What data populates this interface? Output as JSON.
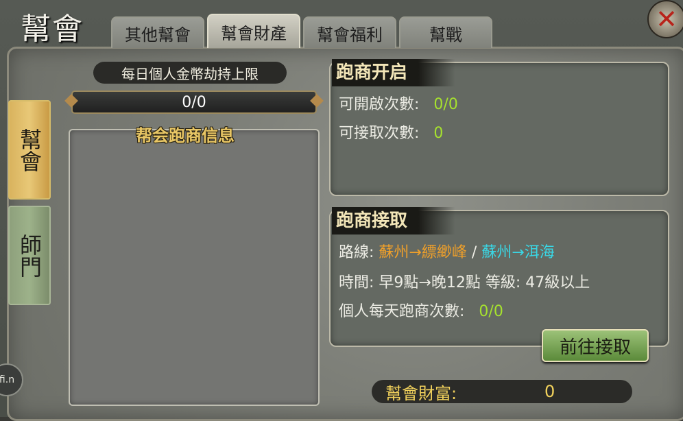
{
  "window": {
    "title": "幫會",
    "close_icon": "close-icon"
  },
  "tabs": [
    {
      "label": "其他幫會",
      "active": false
    },
    {
      "label": "幫會財產",
      "active": true
    },
    {
      "label": "幫會福利",
      "active": false
    },
    {
      "label": "幫戰",
      "active": false
    }
  ],
  "sidebar": {
    "guild_label": "幫會",
    "school_label": "師門"
  },
  "left": {
    "limit_label": "每日個人金幣劫持上限",
    "limit_value": "0/0",
    "info_title": "帮会跑商信息"
  },
  "trade_open": {
    "title": "跑商开启",
    "openable_label": "可開啟次數:",
    "openable_value": "0/0",
    "acceptable_label": "可接取次數:",
    "acceptable_value": "0"
  },
  "trade_accept": {
    "title": "跑商接取",
    "route_label": "路線:",
    "route_1": "蘇州→縹緲峰",
    "route_sep": "/",
    "route_2": "蘇州→洱海",
    "time_text": "時間: 早9點→晚12點 等級: 47級以上",
    "daily_label": "個人每天跑商次數:",
    "daily_value": "0/0",
    "go_button": "前往接取"
  },
  "wealth": {
    "label": "幫會財富:",
    "value": "0"
  },
  "bubble_text": "fi.n",
  "colors": {
    "green": "#a6e22e",
    "orange": "#f0a02a",
    "cyan": "#3ad6e4",
    "gold": "#e9c766"
  }
}
